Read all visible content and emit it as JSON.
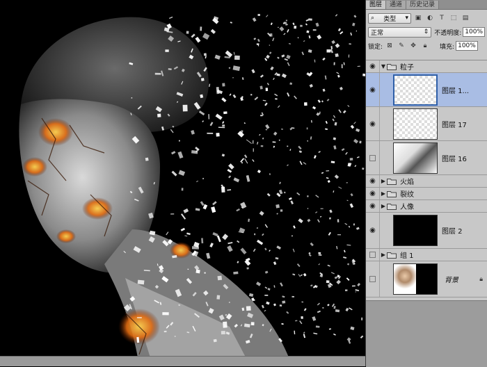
{
  "tabs": [
    "图层",
    "通道",
    "历史记录"
  ],
  "filter": {
    "kind_label": "类型"
  },
  "blend": {
    "mode": "正常",
    "opacity_label": "不透明度:",
    "opacity_value": "100%"
  },
  "lock": {
    "label": "锁定:",
    "fill_label": "填充:",
    "fill_value": "100%"
  },
  "layers": [
    {
      "name": "粒子",
      "type": "group",
      "expanded": true
    },
    {
      "name": "图层 1...",
      "type": "layer",
      "selected": true
    },
    {
      "name": "图层 17",
      "type": "layer"
    },
    {
      "name": "图层 16",
      "type": "layer"
    },
    {
      "name": "火焰",
      "type": "group"
    },
    {
      "name": "裂纹",
      "type": "group"
    },
    {
      "name": "人像",
      "type": "group"
    },
    {
      "name": "图层 2",
      "type": "layer"
    },
    {
      "name": "组 1",
      "type": "group"
    },
    {
      "name": "背景",
      "type": "background"
    }
  ],
  "icons": {
    "search": "search-icon",
    "eye": "eye-icon",
    "folder": "folder-icon",
    "lock": "lock-icon"
  },
  "colors": {
    "selection": "#a9bde4",
    "panel": "#c8c8c8",
    "canvas": "#000000"
  }
}
